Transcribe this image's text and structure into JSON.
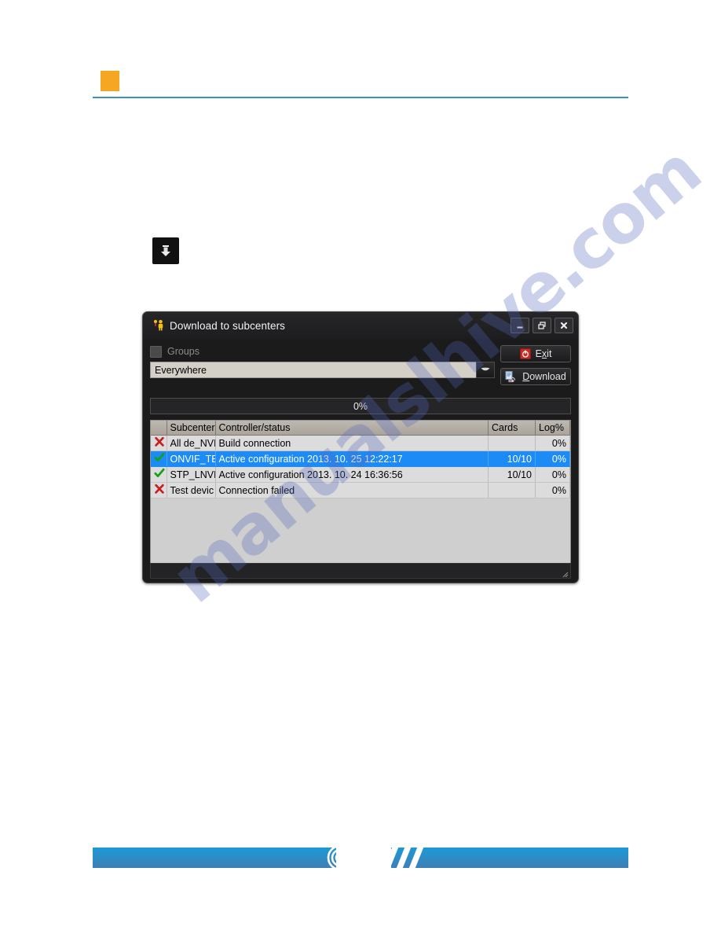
{
  "page": {
    "header_marker_color": "#f5a623",
    "header_rule_color": "#3d8fc6",
    "watermark_text": "manualslhive.com",
    "download_icon_name": "download-arrow-icon"
  },
  "footer": {
    "color_start": "#1b9ad6",
    "color_end": "#3f7fb4"
  },
  "dialog": {
    "title": "Download to subcenters",
    "title_icon": "user-key-icon",
    "window_buttons": {
      "minimize": "minimize-icon",
      "restore": "restore-icon",
      "close": "close-icon"
    },
    "groups": {
      "label": "Groups",
      "checked": false
    },
    "combobox": {
      "value": "Everywhere",
      "options": [
        "Everywhere"
      ]
    },
    "buttons": {
      "exit_label": "E",
      "exit_mnemonic": "x",
      "exit_label_rest": "it",
      "exit_icon": "power-icon",
      "download_mnemonic": "D",
      "download_label_rest": "ownload",
      "download_icon": "document-download-icon"
    },
    "progress": {
      "label": "0%",
      "value": 0
    },
    "table": {
      "columns": [
        "",
        "Subcenter",
        "Controller/status",
        "Cards",
        "Log%"
      ],
      "rows": [
        {
          "status": "error",
          "status_glyph": "✘",
          "subcenter": "All de_NVF",
          "controller_status": "Build connection",
          "cards": "",
          "log": "0%",
          "selected": false
        },
        {
          "status": "ok",
          "status_glyph": "✔",
          "subcenter": "ONVIF_TE",
          "controller_status": "Active configuration 2013. 10. 25 12:22:17",
          "cards": "10/10",
          "log": "0%",
          "selected": true
        },
        {
          "status": "ok",
          "status_glyph": "✔",
          "subcenter": "STP_LNVR",
          "controller_status": "Active configuration 2013. 10. 24 16:36:56",
          "cards": "10/10",
          "log": "0%",
          "selected": false
        },
        {
          "status": "error",
          "status_glyph": "✘",
          "subcenter": "Test devic",
          "controller_status": "Connection failed",
          "cards": "",
          "log": "0%",
          "selected": false
        }
      ]
    }
  }
}
